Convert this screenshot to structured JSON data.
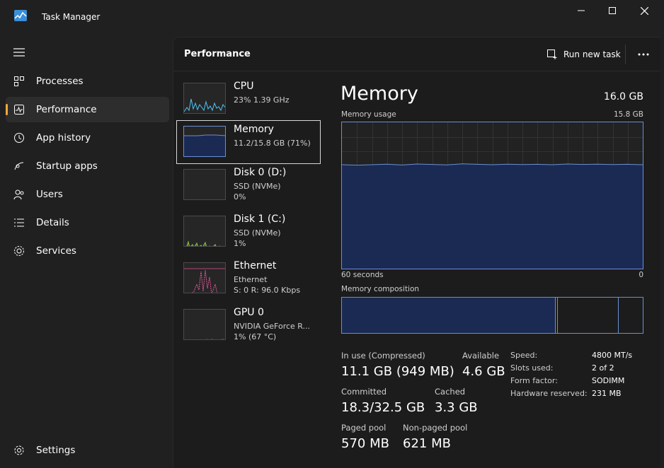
{
  "window": {
    "title": "Task Manager",
    "icons": {
      "minimize": "minimize-icon",
      "maximize": "maximize-icon",
      "close": "close-icon"
    }
  },
  "sidebar": {
    "menu_icon": "hamburger-icon",
    "items": [
      {
        "label": "Processes",
        "icon": "processes-icon",
        "active": false
      },
      {
        "label": "Performance",
        "icon": "performance-icon",
        "active": true
      },
      {
        "label": "App history",
        "icon": "history-icon",
        "active": false
      },
      {
        "label": "Startup apps",
        "icon": "startup-icon",
        "active": false
      },
      {
        "label": "Users",
        "icon": "users-icon",
        "active": false
      },
      {
        "label": "Details",
        "icon": "details-icon",
        "active": false
      },
      {
        "label": "Services",
        "icon": "services-icon",
        "active": false
      }
    ],
    "settings": {
      "label": "Settings",
      "icon": "settings-icon"
    }
  },
  "header": {
    "title": "Performance",
    "run_task_label": "Run new task",
    "more_icon": "more-icon"
  },
  "perf_list": [
    {
      "name": "CPU",
      "line1": "23%  1.39 GHz",
      "line2": "",
      "color": "#4fc3f7"
    },
    {
      "name": "Memory",
      "line1": "11.2/15.8 GB (71%)",
      "line2": "",
      "color": "#6c8fd4"
    },
    {
      "name": "Disk 0 (D:)",
      "line1": "SSD (NVMe)",
      "line2": "0%",
      "color": "#8bc34a"
    },
    {
      "name": "Disk 1 (C:)",
      "line1": "SSD (NVMe)",
      "line2": "1%",
      "color": "#8bc34a"
    },
    {
      "name": "Ethernet",
      "line1": "Ethernet",
      "line2": "S: 0 R: 96.0 Kbps",
      "color": "#e05599"
    },
    {
      "name": "GPU 0",
      "line1": "NVIDIA GeForce R...",
      "line2": "1% (67 °C)",
      "color": "#b36ae2"
    }
  ],
  "detail": {
    "title": "Memory",
    "total": "16.0 GB",
    "usage_label": "Memory usage",
    "usage_max": "15.8 GB",
    "time_left": "60 seconds",
    "time_right": "0",
    "composition_label": "Memory composition",
    "usage_fraction": 0.71,
    "stats": {
      "in_use_label": "In use (Compressed)",
      "in_use_value": "11.1 GB (949 MB)",
      "available_label": "Available",
      "available_value": "4.6 GB",
      "committed_label": "Committed",
      "committed_value": "18.3/32.5 GB",
      "cached_label": "Cached",
      "cached_value": "3.3 GB",
      "paged_label": "Paged pool",
      "paged_value": "570 MB",
      "nonpaged_label": "Non-paged pool",
      "nonpaged_value": "621 MB"
    },
    "specs": [
      {
        "key": "Speed:",
        "value": "4800 MT/s"
      },
      {
        "key": "Slots used:",
        "value": "2 of 2"
      },
      {
        "key": "Form factor:",
        "value": "SODIMM"
      },
      {
        "key": "Hardware reserved:",
        "value": "231 MB"
      }
    ]
  },
  "colors": {
    "accent": "#f7a83a",
    "memory_line": "#6c8fd4",
    "memory_fill": "#1a2a52"
  }
}
